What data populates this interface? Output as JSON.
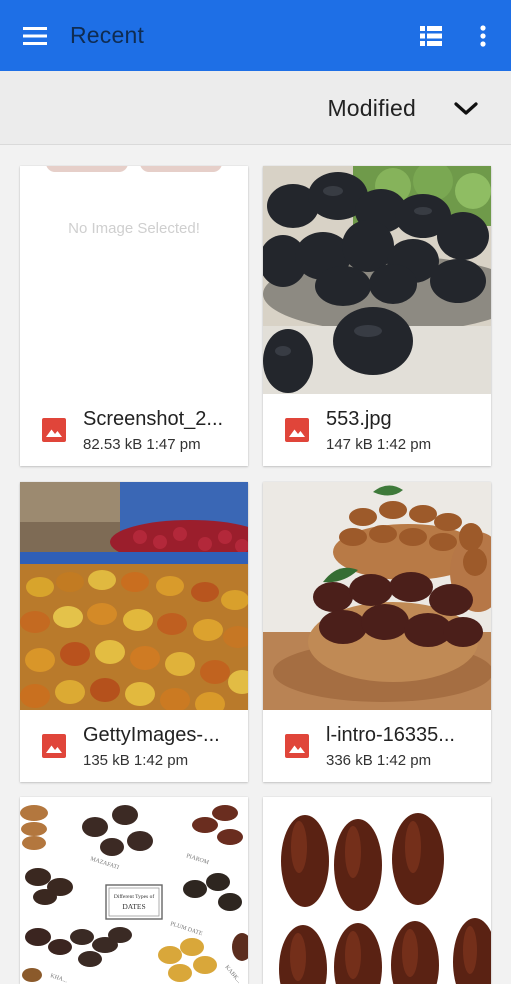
{
  "appbar": {
    "title": "Recent",
    "menu_icon": "hamburger-menu-icon",
    "view_icon": "list-view-icon",
    "overflow_icon": "more-vert-icon"
  },
  "sort": {
    "label": "Modified",
    "toggle_icon": "chevron-down-icon"
  },
  "colors": {
    "appbar": "#1e6fe6",
    "title": "#0f2c52",
    "image_badge": "#e0453a"
  },
  "files": [
    {
      "name": "Screenshot_2...",
      "size": "82.53 kB",
      "time": "1:47 pm",
      "thumb_text": "No Image Selected!"
    },
    {
      "name": "553.jpg",
      "size": "147 kB",
      "time": "1:42 pm"
    },
    {
      "name": "GettyImages-...",
      "size": "135 kB",
      "time": "1:42 pm"
    },
    {
      "name": "l-intro-16335...",
      "size": "336 kB",
      "time": "1:42 pm"
    },
    {
      "name": "",
      "size": "",
      "time": ""
    },
    {
      "name": "",
      "size": "",
      "time": ""
    }
  ],
  "thumb5_text": {
    "line1": "Different Types of",
    "line2": "DATES",
    "labels": [
      "MAZAFATI",
      "PIAROM",
      "PLUM DATE",
      "KHA...",
      "KABK..."
    ]
  }
}
